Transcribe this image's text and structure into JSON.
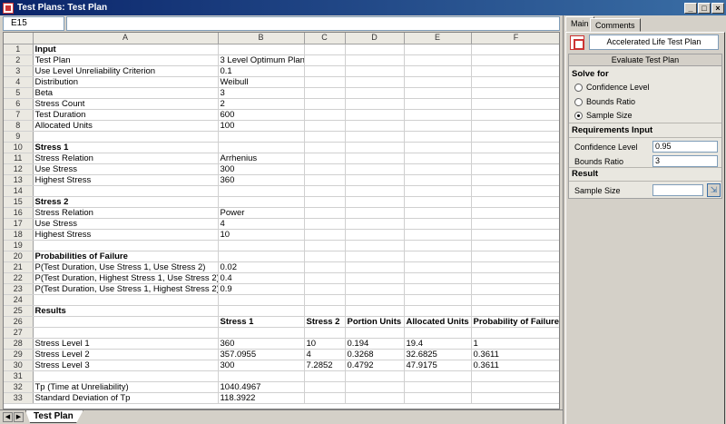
{
  "window": {
    "title": "Test Plans: Test Plan"
  },
  "namebox": "E15",
  "columns": [
    "A",
    "B",
    "C",
    "D",
    "E",
    "F"
  ],
  "rows": [
    {
      "n": "1",
      "a": "Input",
      "b": "",
      "c": "",
      "d": "",
      "e": "",
      "f": "",
      "bold": "a"
    },
    {
      "n": "2",
      "a": "Test Plan",
      "b": "3 Level Optimum Plan",
      "c": "",
      "d": "",
      "e": "",
      "f": ""
    },
    {
      "n": "3",
      "a": "Use Level Unreliability Criterion",
      "b": "0.1",
      "c": "",
      "d": "",
      "e": "",
      "f": ""
    },
    {
      "n": "4",
      "a": "Distribution",
      "b": "Weibull",
      "c": "",
      "d": "",
      "e": "",
      "f": ""
    },
    {
      "n": "5",
      "a": "Beta",
      "b": "3",
      "c": "",
      "d": "",
      "e": "",
      "f": ""
    },
    {
      "n": "6",
      "a": "Stress Count",
      "b": "2",
      "c": "",
      "d": "",
      "e": "",
      "f": ""
    },
    {
      "n": "7",
      "a": "Test Duration",
      "b": "600",
      "c": "",
      "d": "",
      "e": "",
      "f": ""
    },
    {
      "n": "8",
      "a": "Allocated Units",
      "b": "100",
      "c": "",
      "d": "",
      "e": "",
      "f": ""
    },
    {
      "n": "9",
      "a": "",
      "b": "",
      "c": "",
      "d": "",
      "e": "",
      "f": ""
    },
    {
      "n": "10",
      "a": "Stress 1",
      "b": "",
      "c": "",
      "d": "",
      "e": "",
      "f": "",
      "bold": "a"
    },
    {
      "n": "11",
      "a": "Stress Relation",
      "b": "Arrhenius",
      "c": "",
      "d": "",
      "e": "",
      "f": ""
    },
    {
      "n": "12",
      "a": "Use Stress",
      "b": "300",
      "c": "",
      "d": "",
      "e": "",
      "f": ""
    },
    {
      "n": "13",
      "a": "Highest Stress",
      "b": "360",
      "c": "",
      "d": "",
      "e": "",
      "f": ""
    },
    {
      "n": "14",
      "a": "",
      "b": "",
      "c": "",
      "d": "",
      "e": "",
      "f": ""
    },
    {
      "n": "15",
      "a": "Stress 2",
      "b": "",
      "c": "",
      "d": "",
      "e": "",
      "f": "",
      "bold": "a"
    },
    {
      "n": "16",
      "a": "Stress Relation",
      "b": "Power",
      "c": "",
      "d": "",
      "e": "",
      "f": ""
    },
    {
      "n": "17",
      "a": "Use Stress",
      "b": "4",
      "c": "",
      "d": "",
      "e": "",
      "f": ""
    },
    {
      "n": "18",
      "a": "Highest Stress",
      "b": "10",
      "c": "",
      "d": "",
      "e": "",
      "f": ""
    },
    {
      "n": "19",
      "a": "",
      "b": "",
      "c": "",
      "d": "",
      "e": "",
      "f": ""
    },
    {
      "n": "20",
      "a": "Probabilities of Failure",
      "b": "",
      "c": "",
      "d": "",
      "e": "",
      "f": "",
      "bold": "a"
    },
    {
      "n": "21",
      "a": "P(Test Duration, Use Stress 1, Use Stress 2)",
      "b": "0.02",
      "c": "",
      "d": "",
      "e": "",
      "f": ""
    },
    {
      "n": "22",
      "a": "P(Test Duration, Highest Stress 1, Use Stress 2)",
      "b": "0.4",
      "c": "",
      "d": "",
      "e": "",
      "f": ""
    },
    {
      "n": "23",
      "a": "P(Test Duration, Use Stress 1, Highest Stress 2)",
      "b": "0.9",
      "c": "",
      "d": "",
      "e": "",
      "f": ""
    },
    {
      "n": "24",
      "a": "",
      "b": "",
      "c": "",
      "d": "",
      "e": "",
      "f": ""
    },
    {
      "n": "25",
      "a": "Results",
      "b": "",
      "c": "",
      "d": "",
      "e": "",
      "f": "",
      "bold": "a"
    },
    {
      "n": "26",
      "a": "",
      "b": "Stress 1",
      "c": "Stress 2",
      "d": "Portion Units",
      "e": "Allocated Units",
      "f": "Probability of Failure",
      "bold": "all"
    },
    {
      "n": "27",
      "a": "",
      "b": "",
      "c": "",
      "d": "",
      "e": "",
      "f": ""
    },
    {
      "n": "28",
      "a": "Stress Level 1",
      "b": "360",
      "c": "10",
      "d": "0.194",
      "e": "19.4",
      "f": "1"
    },
    {
      "n": "29",
      "a": "Stress Level 2",
      "b": "357.0955",
      "c": "4",
      "d": "0.3268",
      "e": "32.6825",
      "f": "0.3611"
    },
    {
      "n": "30",
      "a": "Stress Level 3",
      "b": "300",
      "c": "7.2852",
      "d": "0.4792",
      "e": "47.9175",
      "f": "0.3611"
    },
    {
      "n": "31",
      "a": "",
      "b": "",
      "c": "",
      "d": "",
      "e": "",
      "f": ""
    },
    {
      "n": "32",
      "a": "Tp (Time at Unreliability)",
      "b": "1040.4967",
      "c": "",
      "d": "",
      "e": "",
      "f": ""
    },
    {
      "n": "33",
      "a": "Standard Deviation of Tp",
      "b": "118.3922",
      "c": "",
      "d": "",
      "e": "",
      "f": ""
    }
  ],
  "sheet_tab": "Test Plan",
  "panel": {
    "tabs": [
      "Main",
      "Comments"
    ],
    "plan_name": "Accelerated Life Test Plan",
    "evaluate_label": "Evaluate Test Plan",
    "solve_for_label": "Solve for",
    "options": [
      "Confidence Level",
      "Bounds Ratio",
      "Sample Size"
    ],
    "selected_option": 2,
    "requirements_label": "Requirements Input",
    "confidence_label": "Confidence Level",
    "confidence_value": "0.95",
    "bounds_label": "Bounds Ratio",
    "bounds_value": "3",
    "result_label": "Result",
    "sample_size_label": "Sample Size",
    "sample_size_value": ""
  }
}
